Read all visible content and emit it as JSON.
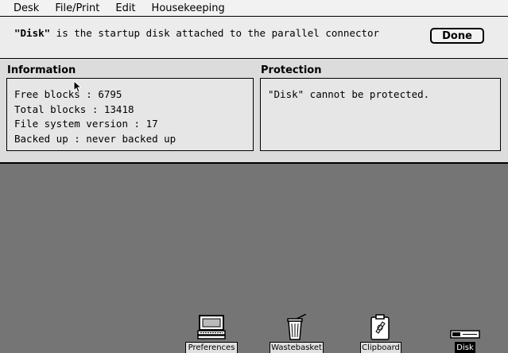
{
  "menubar": {
    "items": [
      "Desk",
      "File/Print",
      "Edit",
      "Housekeeping"
    ]
  },
  "dialog": {
    "disk_name": "\"Disk\"",
    "message_rest": " is the startup disk attached to the parallel connector",
    "done_label": "Done",
    "information": {
      "title": "Information",
      "lines": [
        "Free blocks : 6795",
        "Total blocks : 13418",
        "File system version : 17",
        "Backed up : never backed up"
      ]
    },
    "protection": {
      "title": "Protection",
      "text": "\"Disk\" cannot be protected."
    }
  },
  "desktop": {
    "icons": [
      {
        "label": "Preferences",
        "icon": "preferences-computer-icon"
      },
      {
        "label": "Wastebasket",
        "icon": "wastebasket-icon"
      },
      {
        "label": "Clipboard",
        "icon": "clipboard-icon"
      },
      {
        "label": "Disk",
        "icon": "disk-icon",
        "selected": true
      }
    ]
  }
}
